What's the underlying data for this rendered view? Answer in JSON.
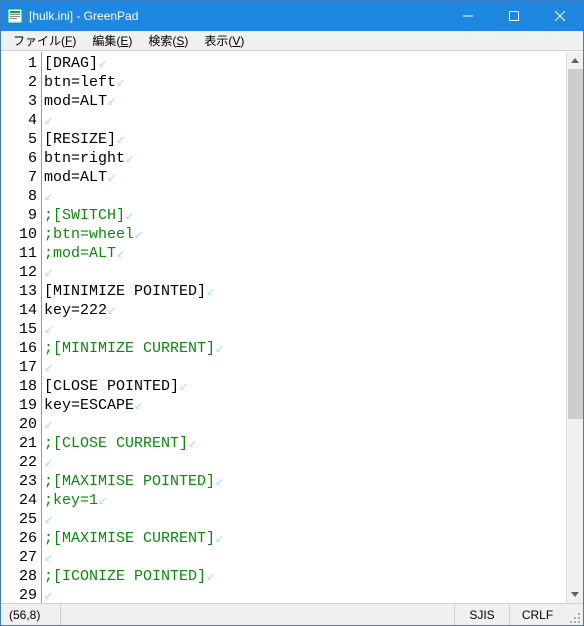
{
  "window": {
    "title": "[hulk.ini] - GreenPad"
  },
  "menu": {
    "items": [
      {
        "label": "ファイル(",
        "accel": "F",
        "suffix": ")"
      },
      {
        "label": "編集(",
        "accel": "E",
        "suffix": ")"
      },
      {
        "label": "検索(",
        "accel": "S",
        "suffix": ")"
      },
      {
        "label": "表示(",
        "accel": "V",
        "suffix": ")"
      }
    ]
  },
  "editor": {
    "lines": [
      {
        "n": 1,
        "text": "[DRAG]",
        "comment": false
      },
      {
        "n": 2,
        "text": "btn=left",
        "comment": false
      },
      {
        "n": 3,
        "text": "mod=ALT",
        "comment": false
      },
      {
        "n": 4,
        "text": "",
        "comment": false
      },
      {
        "n": 5,
        "text": "[RESIZE]",
        "comment": false
      },
      {
        "n": 6,
        "text": "btn=right",
        "comment": false
      },
      {
        "n": 7,
        "text": "mod=ALT",
        "comment": false
      },
      {
        "n": 8,
        "text": "",
        "comment": false
      },
      {
        "n": 9,
        "text": ";[SWITCH]",
        "comment": true
      },
      {
        "n": 10,
        "text": ";btn=wheel",
        "comment": true
      },
      {
        "n": 11,
        "text": ";mod=ALT",
        "comment": true
      },
      {
        "n": 12,
        "text": "",
        "comment": false
      },
      {
        "n": 13,
        "text": "[MINIMIZE POINTED]",
        "comment": false
      },
      {
        "n": 14,
        "text": "key=222",
        "comment": false
      },
      {
        "n": 15,
        "text": "",
        "comment": false
      },
      {
        "n": 16,
        "text": ";[MINIMIZE CURRENT]",
        "comment": true
      },
      {
        "n": 17,
        "text": "",
        "comment": false
      },
      {
        "n": 18,
        "text": "[CLOSE POINTED]",
        "comment": false
      },
      {
        "n": 19,
        "text": "key=ESCAPE",
        "comment": false
      },
      {
        "n": 20,
        "text": "",
        "comment": false
      },
      {
        "n": 21,
        "text": ";[CLOSE CURRENT]",
        "comment": true
      },
      {
        "n": 22,
        "text": "",
        "comment": false
      },
      {
        "n": 23,
        "text": ";[MAXIMISE POINTED]",
        "comment": true
      },
      {
        "n": 24,
        "text": ";key=1",
        "comment": true
      },
      {
        "n": 25,
        "text": "",
        "comment": false
      },
      {
        "n": 26,
        "text": ";[MAXIMISE CURRENT]",
        "comment": true
      },
      {
        "n": 27,
        "text": "",
        "comment": false
      },
      {
        "n": 28,
        "text": ";[ICONIZE POINTED]",
        "comment": true
      },
      {
        "n": 29,
        "text": "",
        "comment": false
      }
    ],
    "eol_marker": "↙"
  },
  "status": {
    "position": "(56,8)",
    "encoding": "SJIS",
    "newline": "CRLF"
  }
}
